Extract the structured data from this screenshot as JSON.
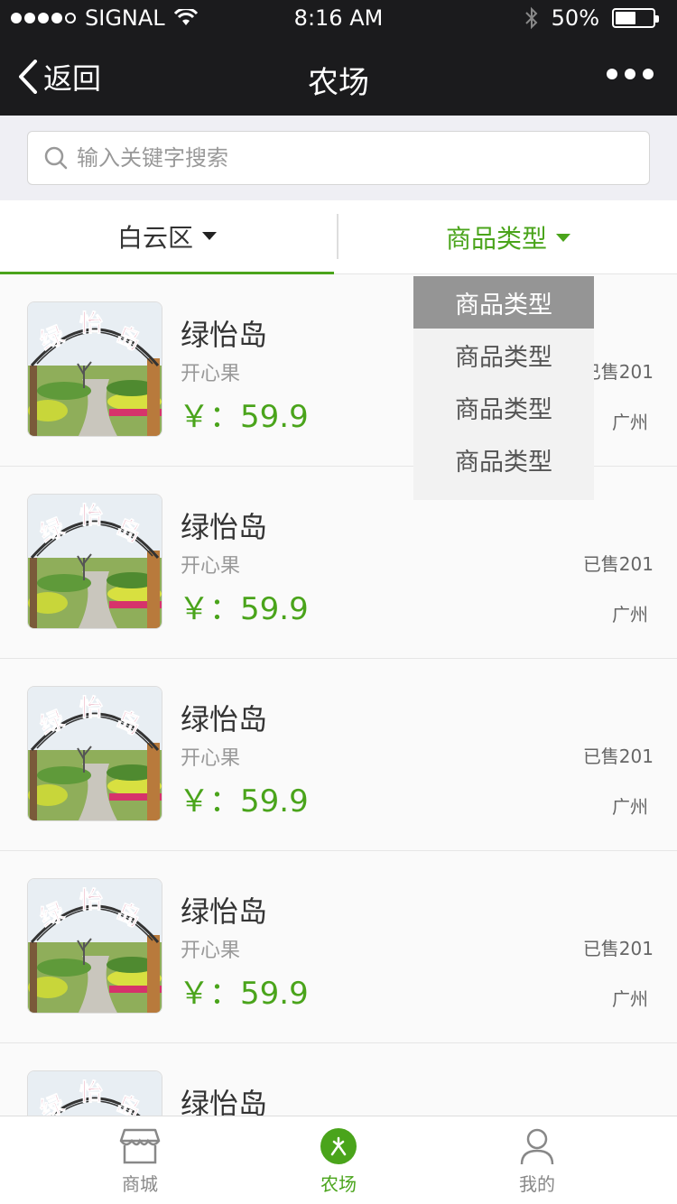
{
  "status_bar": {
    "carrier": "SIGNAL",
    "time": "8:16 AM",
    "battery": "50%"
  },
  "nav": {
    "back_label": "返回",
    "title": "农场"
  },
  "search": {
    "placeholder": "输入关键字搜索"
  },
  "filters": {
    "area": "白云区",
    "type": "商品类型"
  },
  "dropdown": {
    "options": [
      "商品类型",
      "商品类型",
      "商品类型",
      "商品类型"
    ]
  },
  "products": [
    {
      "name": "绿怡岛",
      "sub": "开心果",
      "price": "￥：59.9",
      "sold": "已售201",
      "city": "广州"
    },
    {
      "name": "绿怡岛",
      "sub": "开心果",
      "price": "￥：59.9",
      "sold": "已售201",
      "city": "广州"
    },
    {
      "name": "绿怡岛",
      "sub": "开心果",
      "price": "￥：59.9",
      "sold": "已售201",
      "city": "广州"
    },
    {
      "name": "绿怡岛",
      "sub": "开心果",
      "price": "￥：59.9",
      "sold": "已售201",
      "city": "广州"
    },
    {
      "name": "绿怡岛"
    }
  ],
  "thumb_sign": "绿怡岛",
  "tabs": [
    {
      "label": "商城",
      "icon": "shop-icon"
    },
    {
      "label": "农场",
      "icon": "farm-icon"
    },
    {
      "label": "我的",
      "icon": "user-icon"
    }
  ],
  "colors": {
    "accent": "#4aa41b",
    "nav_bg": "#1b1b1d"
  }
}
